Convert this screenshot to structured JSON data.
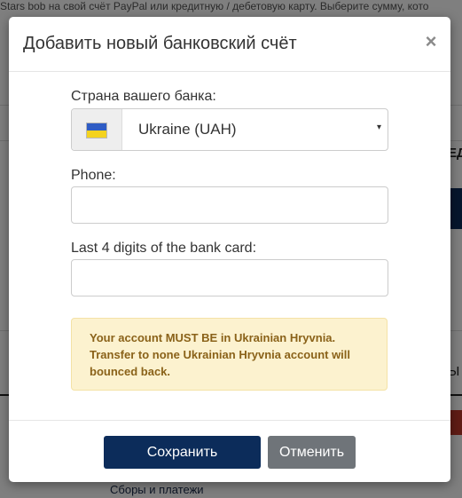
{
  "background": {
    "top_text": "Stars bob на свой счёт PayPal или кредитную / дебетовую карту. Выберите сумму, кото",
    "right_fragment_1": "ЕД",
    "right_fragment_2": "Ы",
    "bottom_link": "Сборы и платежи"
  },
  "modal": {
    "title": "Добавить новый банковский счёт",
    "close_label": "×",
    "country": {
      "label": "Страна вашего банка:",
      "selected_value": "Ukraine (UAH)",
      "flag_icon": "ukraine-flag-icon",
      "flag_colors": [
        "#2f5cc4",
        "#f4d31f"
      ],
      "caret": "▾"
    },
    "phone": {
      "label": "Phone:",
      "value": "",
      "placeholder": ""
    },
    "card_digits": {
      "label": "Last 4 digits of the bank card:",
      "value": "",
      "placeholder": ""
    },
    "warning": "Your account MUST BE in Ukrainian Hryvnia. Transfer to none Ukrainian Hryvnia account will bounced back.",
    "buttons": {
      "save": "Сохранить",
      "cancel": "Отменить"
    }
  },
  "colors": {
    "primary": "#0c2c5a",
    "secondary": "#6f7479",
    "warning_bg": "#fcf2cf",
    "warning_text": "#8a6219"
  }
}
